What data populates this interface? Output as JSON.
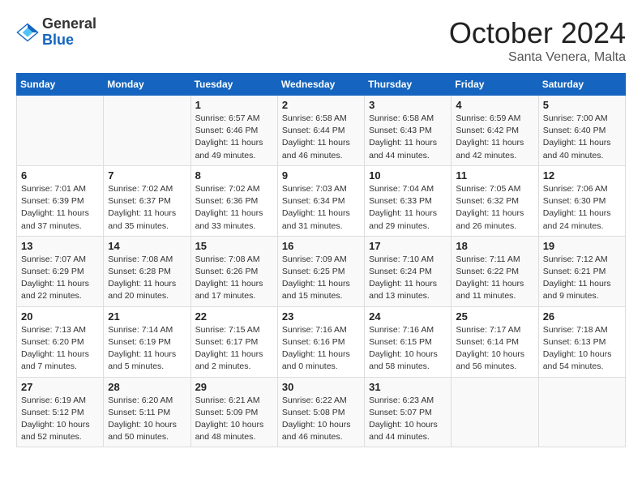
{
  "header": {
    "logo_line1": "General",
    "logo_line2": "Blue",
    "month": "October 2024",
    "location": "Santa Venera, Malta"
  },
  "weekdays": [
    "Sunday",
    "Monday",
    "Tuesday",
    "Wednesday",
    "Thursday",
    "Friday",
    "Saturday"
  ],
  "weeks": [
    [
      {
        "day": "",
        "info": ""
      },
      {
        "day": "",
        "info": ""
      },
      {
        "day": "1",
        "info": "Sunrise: 6:57 AM\nSunset: 6:46 PM\nDaylight: 11 hours and 49 minutes."
      },
      {
        "day": "2",
        "info": "Sunrise: 6:58 AM\nSunset: 6:44 PM\nDaylight: 11 hours and 46 minutes."
      },
      {
        "day": "3",
        "info": "Sunrise: 6:58 AM\nSunset: 6:43 PM\nDaylight: 11 hours and 44 minutes."
      },
      {
        "day": "4",
        "info": "Sunrise: 6:59 AM\nSunset: 6:42 PM\nDaylight: 11 hours and 42 minutes."
      },
      {
        "day": "5",
        "info": "Sunrise: 7:00 AM\nSunset: 6:40 PM\nDaylight: 11 hours and 40 minutes."
      }
    ],
    [
      {
        "day": "6",
        "info": "Sunrise: 7:01 AM\nSunset: 6:39 PM\nDaylight: 11 hours and 37 minutes."
      },
      {
        "day": "7",
        "info": "Sunrise: 7:02 AM\nSunset: 6:37 PM\nDaylight: 11 hours and 35 minutes."
      },
      {
        "day": "8",
        "info": "Sunrise: 7:02 AM\nSunset: 6:36 PM\nDaylight: 11 hours and 33 minutes."
      },
      {
        "day": "9",
        "info": "Sunrise: 7:03 AM\nSunset: 6:34 PM\nDaylight: 11 hours and 31 minutes."
      },
      {
        "day": "10",
        "info": "Sunrise: 7:04 AM\nSunset: 6:33 PM\nDaylight: 11 hours and 29 minutes."
      },
      {
        "day": "11",
        "info": "Sunrise: 7:05 AM\nSunset: 6:32 PM\nDaylight: 11 hours and 26 minutes."
      },
      {
        "day": "12",
        "info": "Sunrise: 7:06 AM\nSunset: 6:30 PM\nDaylight: 11 hours and 24 minutes."
      }
    ],
    [
      {
        "day": "13",
        "info": "Sunrise: 7:07 AM\nSunset: 6:29 PM\nDaylight: 11 hours and 22 minutes."
      },
      {
        "day": "14",
        "info": "Sunrise: 7:08 AM\nSunset: 6:28 PM\nDaylight: 11 hours and 20 minutes."
      },
      {
        "day": "15",
        "info": "Sunrise: 7:08 AM\nSunset: 6:26 PM\nDaylight: 11 hours and 17 minutes."
      },
      {
        "day": "16",
        "info": "Sunrise: 7:09 AM\nSunset: 6:25 PM\nDaylight: 11 hours and 15 minutes."
      },
      {
        "day": "17",
        "info": "Sunrise: 7:10 AM\nSunset: 6:24 PM\nDaylight: 11 hours and 13 minutes."
      },
      {
        "day": "18",
        "info": "Sunrise: 7:11 AM\nSunset: 6:22 PM\nDaylight: 11 hours and 11 minutes."
      },
      {
        "day": "19",
        "info": "Sunrise: 7:12 AM\nSunset: 6:21 PM\nDaylight: 11 hours and 9 minutes."
      }
    ],
    [
      {
        "day": "20",
        "info": "Sunrise: 7:13 AM\nSunset: 6:20 PM\nDaylight: 11 hours and 7 minutes."
      },
      {
        "day": "21",
        "info": "Sunrise: 7:14 AM\nSunset: 6:19 PM\nDaylight: 11 hours and 5 minutes."
      },
      {
        "day": "22",
        "info": "Sunrise: 7:15 AM\nSunset: 6:17 PM\nDaylight: 11 hours and 2 minutes."
      },
      {
        "day": "23",
        "info": "Sunrise: 7:16 AM\nSunset: 6:16 PM\nDaylight: 11 hours and 0 minutes."
      },
      {
        "day": "24",
        "info": "Sunrise: 7:16 AM\nSunset: 6:15 PM\nDaylight: 10 hours and 58 minutes."
      },
      {
        "day": "25",
        "info": "Sunrise: 7:17 AM\nSunset: 6:14 PM\nDaylight: 10 hours and 56 minutes."
      },
      {
        "day": "26",
        "info": "Sunrise: 7:18 AM\nSunset: 6:13 PM\nDaylight: 10 hours and 54 minutes."
      }
    ],
    [
      {
        "day": "27",
        "info": "Sunrise: 6:19 AM\nSunset: 5:12 PM\nDaylight: 10 hours and 52 minutes."
      },
      {
        "day": "28",
        "info": "Sunrise: 6:20 AM\nSunset: 5:11 PM\nDaylight: 10 hours and 50 minutes."
      },
      {
        "day": "29",
        "info": "Sunrise: 6:21 AM\nSunset: 5:09 PM\nDaylight: 10 hours and 48 minutes."
      },
      {
        "day": "30",
        "info": "Sunrise: 6:22 AM\nSunset: 5:08 PM\nDaylight: 10 hours and 46 minutes."
      },
      {
        "day": "31",
        "info": "Sunrise: 6:23 AM\nSunset: 5:07 PM\nDaylight: 10 hours and 44 minutes."
      },
      {
        "day": "",
        "info": ""
      },
      {
        "day": "",
        "info": ""
      }
    ]
  ]
}
